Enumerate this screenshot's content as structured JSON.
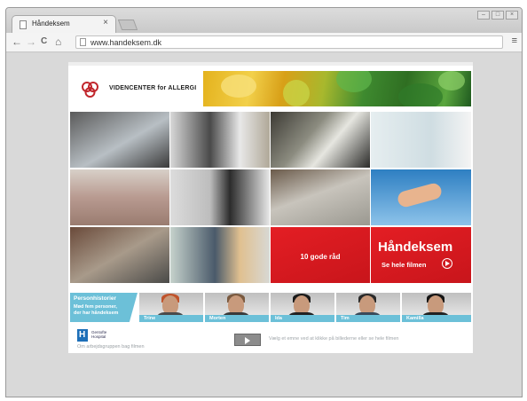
{
  "browser": {
    "tab_title": "Håndeksem",
    "tab_close": "×",
    "url": "www.handeksem.dk",
    "back": "←",
    "forward": "→",
    "reload": "C",
    "home": "⌂",
    "menu": "≡",
    "win_min": "–",
    "win_max": "□",
    "win_close": "×"
  },
  "header": {
    "logo_text": "VIDENCENTER for ALLERGI"
  },
  "tiles": {
    "tips": "10 gode råd",
    "film_title": "Håndeksem",
    "film_link": "Se hele filmen"
  },
  "persons": {
    "intro": [
      "Personhistorier",
      "Mød fem personer,",
      "der har håndeksem"
    ],
    "people": [
      {
        "name": "Trine"
      },
      {
        "name": "Morten"
      },
      {
        "name": "Ida"
      },
      {
        "name": "Tim"
      },
      {
        "name": "Kamilla"
      }
    ]
  },
  "footer": {
    "hospital_line1": "Gentofte",
    "hospital_line2": "Hospital",
    "subtitle": "Om arbejdsgruppen bag filmen",
    "hint": "Vælg et emne ved at klikke på billederne eller se hele filmen"
  },
  "colors": {
    "accent_red": "#e41e24",
    "accent_cyan": "#6cc0d8"
  }
}
